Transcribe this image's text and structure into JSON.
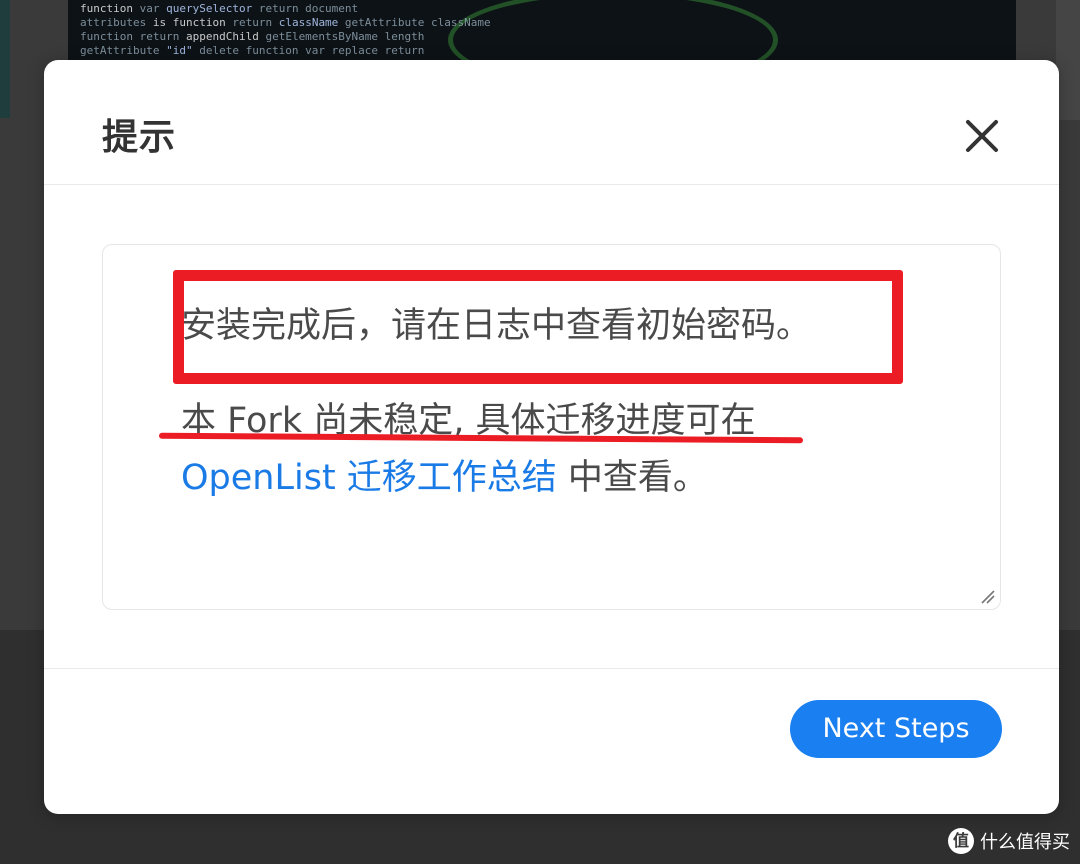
{
  "dialog": {
    "title": "提示",
    "close_icon": "close-icon",
    "message": {
      "line1": "安装完成后，请在日志中查看初始密码。",
      "line2": "本 Fork 尚未稳定, 具体迁移进度可在",
      "link_text": "OpenList 迁移工作总结",
      "line3_suffix": " 中查看。"
    },
    "primary_button_label": "Next Steps"
  },
  "annotations": {
    "highlight_color": "#ec1c24"
  },
  "watermark": {
    "logo": "值",
    "text": "什么值得买"
  },
  "colors": {
    "primary": "#1a7ff0",
    "link": "#1a7ae6",
    "text": "#4a4a4a",
    "title": "#333333"
  }
}
